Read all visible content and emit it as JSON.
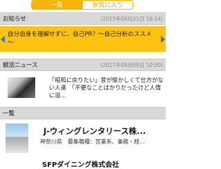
{
  "tabs": {
    "list_label": "一覧",
    "favorites_label": "お気に入り"
  },
  "notices": {
    "title": "お知らせ",
    "date": "(2015年04月21日 16:14)",
    "text": "自分自身を理解せずに、自己PR？～自己分析のススメ～"
  },
  "news": {
    "title": "就活ニュース",
    "date": "(2017年09月09日 10:00)",
    "text": "「昭和に戻りたい」昔が懐かしくて仕方がない人達　「不便なことばかりだったけど人情に溢..."
  },
  "listing": {
    "title": "一覧",
    "companies": [
      {
        "name": "J-ウィングレンタリース株...",
        "detail": "神奈川県　募集職種：営業系、事務・経..."
      },
      {
        "name": "SFPダイニング株式会社"
      }
    ]
  },
  "colors": {
    "accent": "#ffc20e",
    "arrow": "#1e7fc2",
    "tab_active": "#f7b400"
  }
}
